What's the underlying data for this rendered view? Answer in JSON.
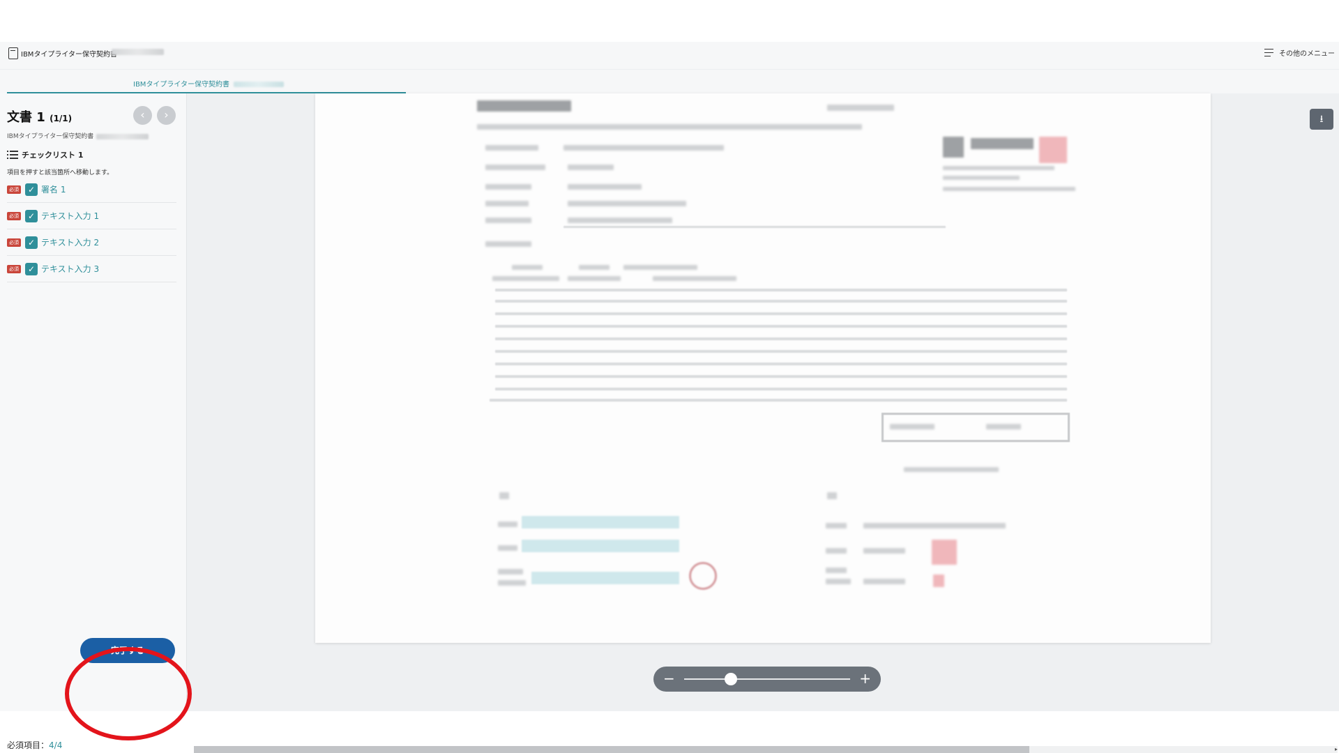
{
  "topbar": {
    "app_title": "IBMタイプライター保守契約書",
    "menu_label": "その他のメニュー"
  },
  "tab": {
    "label": "IBMタイプライター保守契約書"
  },
  "sidebar": {
    "doc_title": "文書 1",
    "doc_counter": "(1/1)",
    "doc_subtitle": "IBMタイプライター保守契約書",
    "checklist_title": "チェックリスト 1",
    "checklist_hint": "項目を押すと該当箇所へ移動します。",
    "items": [
      {
        "badge": "必須",
        "label": "署名 1",
        "checked": true
      },
      {
        "badge": "必須",
        "label": "テキスト入力 1",
        "checked": true
      },
      {
        "badge": "必須",
        "label": "テキスト入力 2",
        "checked": true
      },
      {
        "badge": "必須",
        "label": "テキスト入力 3",
        "checked": true
      }
    ],
    "status_label": "必須項目：",
    "status_count": "4/4",
    "complete_button": "完了する"
  },
  "viewer": {
    "zoom_minus": "−",
    "zoom_plus": "+",
    "zoom_level": 0.28
  },
  "icons": {
    "prev": "chevron-left-icon",
    "next": "chevron-right-icon",
    "download": "download-icon",
    "menu": "menu-lines-icon",
    "check": "checkmark-icon"
  },
  "colors": {
    "accent": "#2f8f9a",
    "primary_button": "#1b5fa5",
    "required_badge": "#c9453a",
    "highlight_circle": "#e3141b"
  }
}
